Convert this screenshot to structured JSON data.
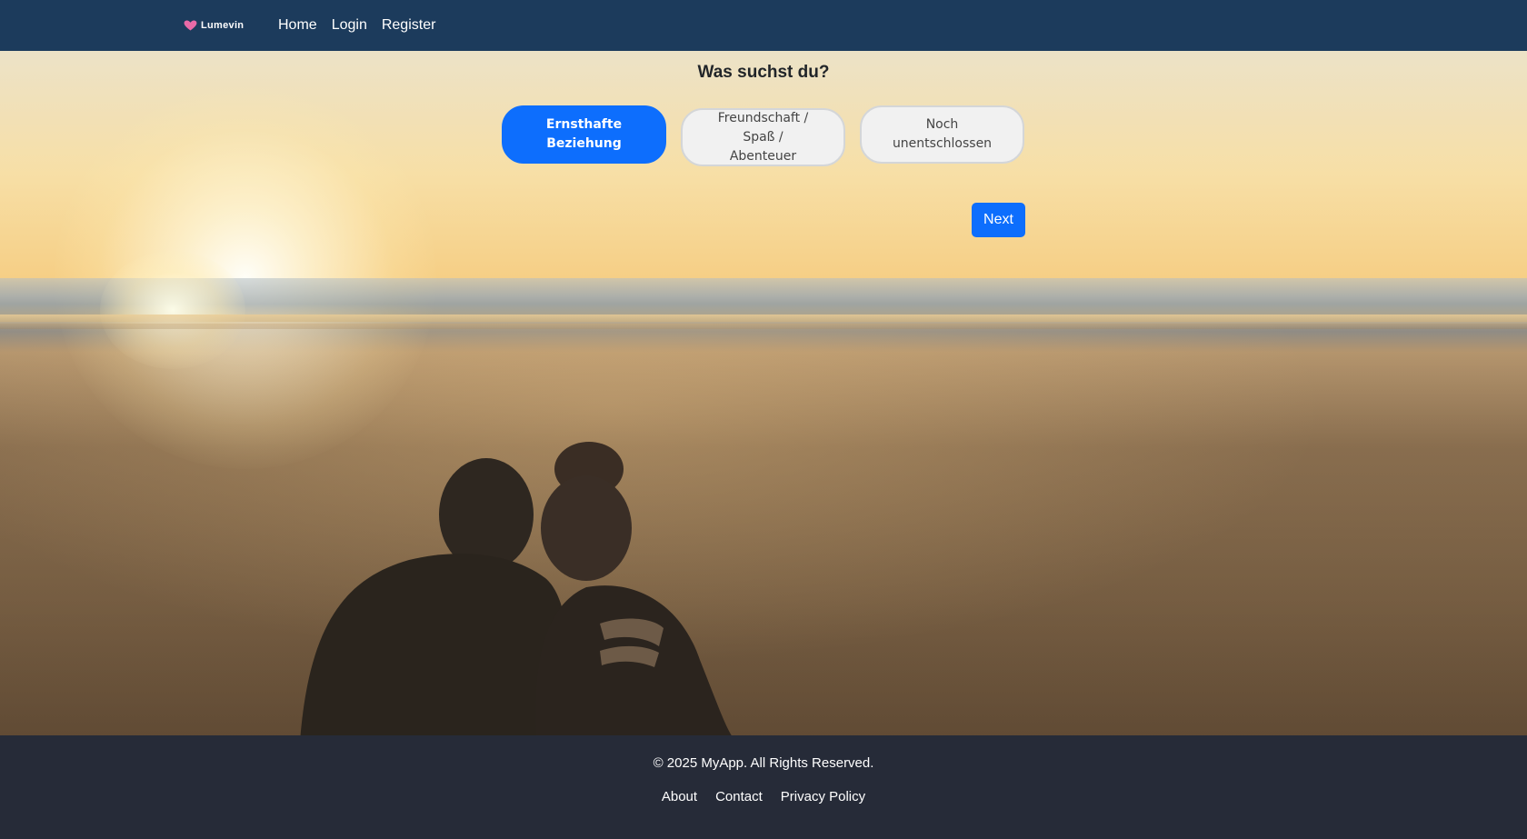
{
  "navbar": {
    "brand": "Lumevin",
    "links": [
      "Home",
      "Login",
      "Register"
    ]
  },
  "main": {
    "question": "Was suchst du?",
    "options": [
      {
        "label_lines": [
          "Ernsthafte",
          "Beziehung"
        ],
        "selected": true
      },
      {
        "label_lines": [
          "Freundschaft /",
          "Spaß /",
          "Abenteuer"
        ],
        "selected": false
      },
      {
        "label_lines": [
          "Noch",
          "unentschlossen"
        ],
        "selected": false
      }
    ],
    "next_label": "Next"
  },
  "footer": {
    "copyright": "© 2025 MyApp. All Rights Reserved.",
    "links": [
      "About",
      "Contact",
      "Privacy Policy"
    ]
  },
  "colors": {
    "navbar_bg": "#1c3b5c",
    "primary": "#0d6efd",
    "footer_bg": "#262b38",
    "brand_heart": "#e86aa7"
  },
  "icons": {
    "brand_icon": "heart-icon"
  }
}
